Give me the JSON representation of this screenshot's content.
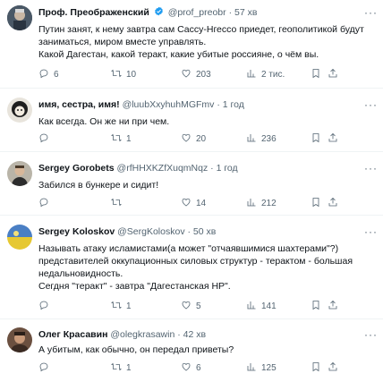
{
  "tweets": [
    {
      "name": "Проф. Преображенский",
      "handle": "@prof_preobr",
      "time": "57 хв",
      "lines": [
        "Путин занят, к нему завтра сам Сассу-Нгессо приедет, геополитикой будут",
        "заниматься, миром вместе управлять.",
        "Какой Дагестан, какой теракт, какие убитые россияне, о чём вы."
      ],
      "replies": "6",
      "retweets": "10",
      "likes": "203",
      "views": "2 тис."
    },
    {
      "name": "имя, сестра, имя!",
      "handle": "@luubXxyhuhMGFmv",
      "time": "1 год",
      "lines": [
        "Как всегда. Он же ни при чем."
      ],
      "replies": "",
      "retweets": "1",
      "likes": "20",
      "views": "236"
    },
    {
      "name": "Sergey Gorobets",
      "handle": "@rfHHXKZfXuqmNqz",
      "time": "1 год",
      "lines": [
        "Забился в бункере и сидит!"
      ],
      "replies": "",
      "retweets": "",
      "likes": "14",
      "views": "212"
    },
    {
      "name": "Sergey Koloskov",
      "handle": "@SergKoloskov",
      "time": "50 хв",
      "lines": [
        "Называть атаку исламистами(а может \"отчаявшимися шахтерами\"?)",
        "представителей оккупационных силовых структур - терактом - большая",
        "недальновидность.",
        "Сегдня \"теракт\" - завтра \"Дагестанская НР\"."
      ],
      "replies": "",
      "retweets": "1",
      "likes": "5",
      "views": "141"
    },
    {
      "name": "Олег Красавин",
      "handle": "@olegkrasawin",
      "time": "42 хв",
      "lines": [
        "А убитым, как обычно, он передал приветы?"
      ],
      "replies": "",
      "retweets": "1",
      "likes": "6",
      "views": "125"
    }
  ],
  "separators": "·",
  "more_label": "···",
  "icons": {
    "verified": "verified-badge-icon",
    "reply": "reply-icon",
    "retweet": "retweet-icon",
    "like": "like-icon",
    "views": "views-icon",
    "bookmark": "bookmark-icon",
    "share": "share-icon"
  },
  "colors": {
    "verified": "#1d9bf0",
    "meta": "#536471",
    "text": "#0f1419",
    "divider": "#eff3f4"
  }
}
